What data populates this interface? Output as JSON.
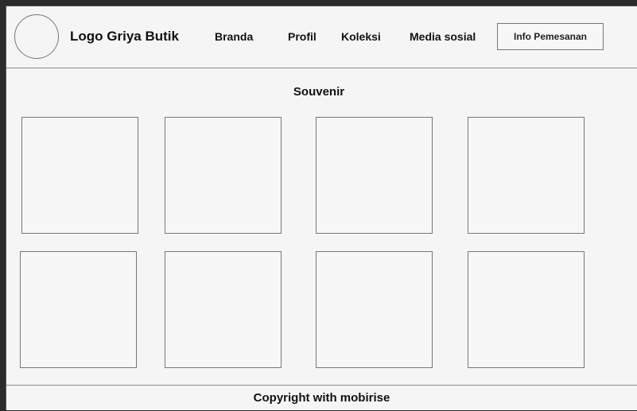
{
  "header": {
    "logo_text": "Logo Griya Butik",
    "nav": [
      "Branda",
      "Profil",
      "Koleksi",
      "Media sosial"
    ],
    "order_button": "Info Pemesanan"
  },
  "section": {
    "title": "Souvenir",
    "item_count": 8
  },
  "footer": {
    "text": "Copyright with mobirise"
  }
}
